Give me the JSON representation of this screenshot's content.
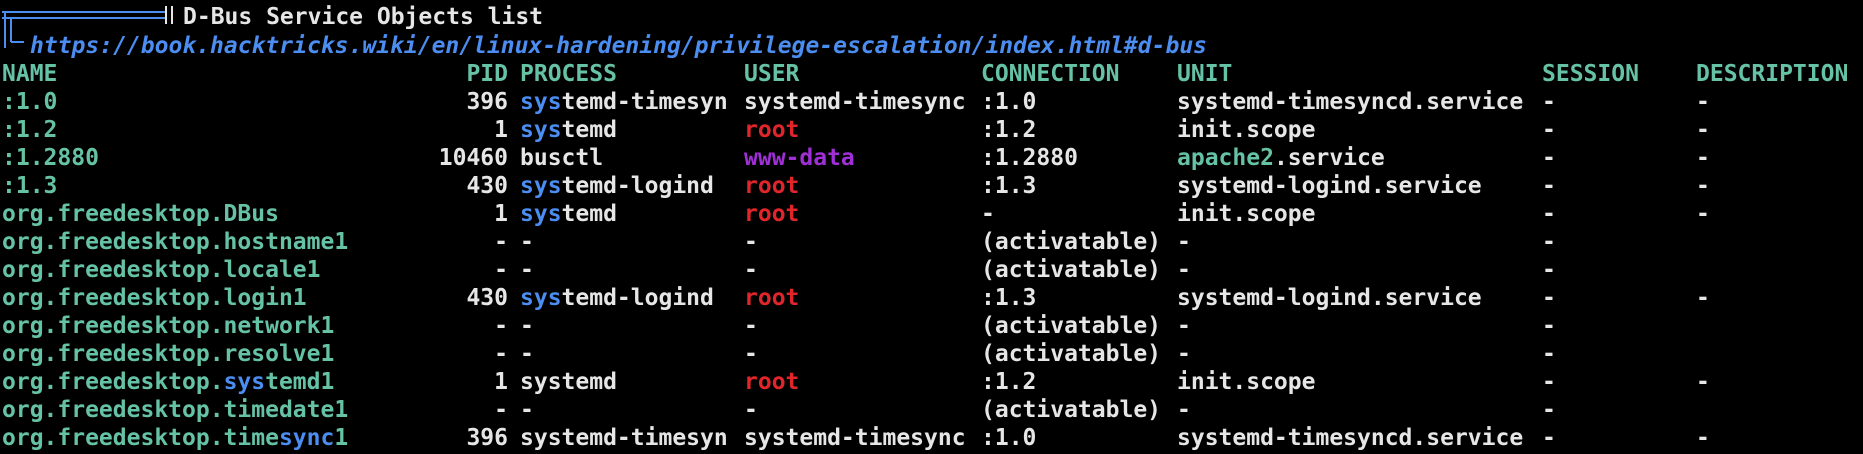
{
  "header": {
    "title": "D-Bus Service Objects list",
    "link": "https://book.hacktricks.wiki/en/linux-hardening/privilege-escalation/index.html#d-bus"
  },
  "columns": [
    "NAME",
    "PID",
    "PROCESS",
    "USER",
    "CONNECTION",
    "UNIT",
    "SESSION",
    "DESCRIPTION"
  ],
  "colors": {
    "name": "#66c2a5",
    "highlight": "#4b8df0",
    "root": "#e0262a",
    "www_data": "#a02fd6",
    "text": "#e6e6e6"
  },
  "rows": [
    {
      "name": [
        ":1.0"
      ],
      "pid": "396",
      "process": [
        "sys",
        "temd-timesyn"
      ],
      "user": "systemd-timesync",
      "user_style": "plain",
      "connection": ":1.0",
      "unit": [
        "",
        "systemd-timesyncd.service"
      ],
      "session": "-",
      "description": "-"
    },
    {
      "name": [
        ":1.2"
      ],
      "pid": "1",
      "process": [
        "sys",
        "temd"
      ],
      "user": "root",
      "user_style": "root",
      "connection": ":1.2",
      "unit": [
        "",
        "init.scope"
      ],
      "session": "-",
      "description": "-"
    },
    {
      "name": [
        ":1.2880"
      ],
      "pid": "10460",
      "process": [
        "",
        "busctl"
      ],
      "user": "www-data",
      "user_style": "www",
      "connection": ":1.2880",
      "unit": [
        "apache2",
        ".service"
      ],
      "session": "-",
      "description": "-"
    },
    {
      "name": [
        ":1.3"
      ],
      "pid": "430",
      "process": [
        "sys",
        "temd-logind"
      ],
      "user": "root",
      "user_style": "root",
      "connection": ":1.3",
      "unit": [
        "",
        "systemd-logind.service"
      ],
      "session": "-",
      "description": "-"
    },
    {
      "name": [
        "org.freedesktop.DBus"
      ],
      "pid": "1",
      "process": [
        "sys",
        "temd"
      ],
      "user": "root",
      "user_style": "root",
      "connection": "-",
      "unit": [
        "",
        "init.scope"
      ],
      "session": "-",
      "description": "-"
    },
    {
      "name": [
        "org.freedesktop.hostname1"
      ],
      "pid": "-",
      "process": [
        "",
        "-"
      ],
      "user": "-",
      "user_style": "plain",
      "connection": "(activatable)",
      "unit": [
        "",
        "-"
      ],
      "session": "-",
      "description": ""
    },
    {
      "name": [
        "org.freedesktop.locale1"
      ],
      "pid": "-",
      "process": [
        "",
        "-"
      ],
      "user": "-",
      "user_style": "plain",
      "connection": "(activatable)",
      "unit": [
        "",
        "-"
      ],
      "session": "-",
      "description": ""
    },
    {
      "name": [
        "org.freedesktop.login1"
      ],
      "pid": "430",
      "process": [
        "sys",
        "temd-logind"
      ],
      "user": "root",
      "user_style": "root",
      "connection": ":1.3",
      "unit": [
        "",
        "systemd-logind.service"
      ],
      "session": "-",
      "description": "-"
    },
    {
      "name": [
        "org.freedesktop.network1"
      ],
      "pid": "-",
      "process": [
        "",
        "-"
      ],
      "user": "-",
      "user_style": "plain",
      "connection": "(activatable)",
      "unit": [
        "",
        "-"
      ],
      "session": "-",
      "description": ""
    },
    {
      "name": [
        "org.freedesktop.resolve1"
      ],
      "pid": "-",
      "process": [
        "",
        "-"
      ],
      "user": "-",
      "user_style": "plain",
      "connection": "(activatable)",
      "unit": [
        "",
        "-"
      ],
      "session": "-",
      "description": ""
    },
    {
      "name": [
        "org.freedesktop.",
        "sys",
        "temd1"
      ],
      "pid": "1",
      "process": [
        "",
        "systemd"
      ],
      "user": "root",
      "user_style": "root",
      "connection": ":1.2",
      "unit": [
        "",
        "init.scope"
      ],
      "session": "-",
      "description": "-"
    },
    {
      "name": [
        "org.freedesktop.timedate1"
      ],
      "pid": "-",
      "process": [
        "",
        "-"
      ],
      "user": "-",
      "user_style": "plain",
      "connection": "(activatable)",
      "unit": [
        "",
        "-"
      ],
      "session": "-",
      "description": ""
    },
    {
      "name": [
        "org.freedesktop.time",
        "sync",
        "1"
      ],
      "pid": "396",
      "process": [
        "",
        "systemd-timesyn"
      ],
      "user": "systemd-timesync",
      "user_style": "plain",
      "connection": ":1.0",
      "unit": [
        "",
        "systemd-timesyncd.service"
      ],
      "session": "-",
      "description": "-"
    }
  ]
}
